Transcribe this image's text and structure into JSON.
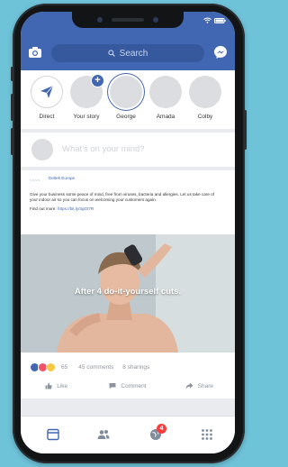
{
  "search": {
    "label": "Search"
  },
  "stories": [
    {
      "label": "Direct"
    },
    {
      "label": "Your story"
    },
    {
      "label": "George"
    },
    {
      "label": "Amada"
    },
    {
      "label": "Colby"
    }
  ],
  "composer": {
    "prompt": "What's on your mind?"
  },
  "post": {
    "page_logo": "~~~~",
    "page_name": "Deltek Europe",
    "time": "",
    "body_1": "Give your business some peace of mind, free from viruses, bacteria and allergies. Let us take care of your indoor air so you can focus on welcoming your customers again.",
    "body_2_prefix": "Find out more: ",
    "body_2_link": "https://bit.ly/3gGt7R",
    "caption": "After 4 do-it-yourself cuts.",
    "reaction_count": "65",
    "comments": "45 comments",
    "shares": "8 sharings",
    "like_label": "Like",
    "comment_label": "Comment",
    "share_label": "Share"
  },
  "tabbar": {
    "notif_count": "4"
  },
  "colors": {
    "brand": "#4267b2",
    "background": "#6fc3d9",
    "badge": "#fa3e3e"
  }
}
